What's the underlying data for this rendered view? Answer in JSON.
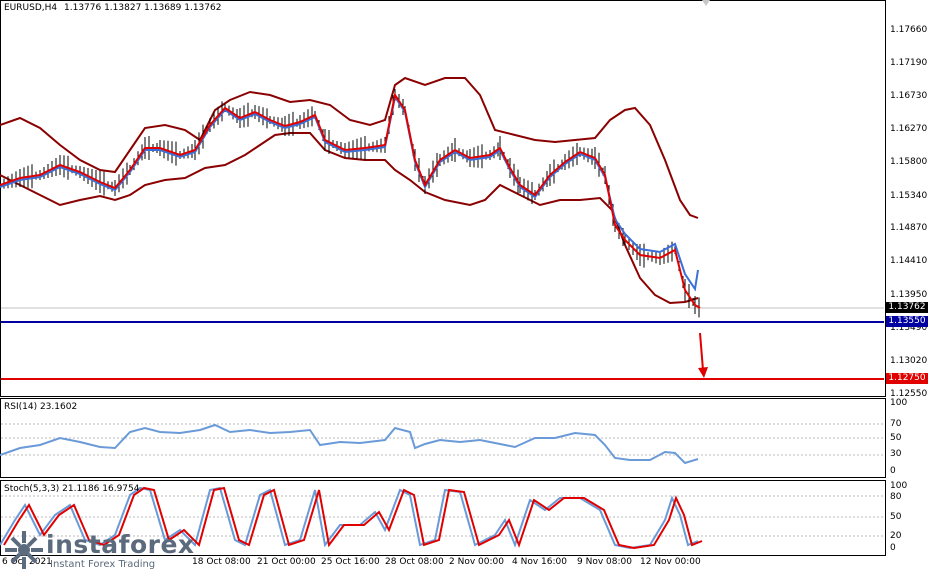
{
  "header": {
    "symbol": "EURUSD,H4",
    "ohlc": "1.13776 1.13827 1.13689 1.13762"
  },
  "price_axis": [
    "1.17660",
    "1.17190",
    "1.16730",
    "1.16270",
    "1.15800",
    "1.15340",
    "1.14870",
    "1.14410",
    "1.13950",
    "1.13490",
    "1.13020",
    "1.12550"
  ],
  "price_tags": {
    "current": {
      "label": "1.13762",
      "color": "#000000"
    },
    "blue_line": {
      "label": "1.13550",
      "color": "#0000a0"
    },
    "red_line": {
      "label": "1.12750",
      "color": "#e00000"
    }
  },
  "rsi": {
    "label": "RSI(14) 23.1602",
    "levels": [
      "100",
      "70",
      "50",
      "30",
      "0"
    ]
  },
  "stoch": {
    "label": "Stoch(5,3,3) 21.1186 16.9754",
    "levels": [
      "100",
      "80",
      "50",
      "20",
      "0"
    ]
  },
  "time_axis": [
    "6 Oct 2021",
    "18 Oct 08:00",
    "21 Oct 00:00",
    "25 Oct 16:00",
    "28 Oct 08:00",
    "2 Nov 00:00",
    "4 Nov 16:00",
    "9 Nov 08:00",
    "12 Nov 00:00"
  ],
  "logo": {
    "word": "instaforex",
    "tagline": "Instant Forex Trading"
  },
  "colors": {
    "bollinger": "#8b0000",
    "ma_fast": "#e00000",
    "ma_slow": "#3a6fd8",
    "horizontal_blue": "#0000a0",
    "horizontal_red": "#e00000",
    "rsi": "#6a9ad8",
    "stoch_main": "#6a9ad8",
    "stoch_signal": "#e00000"
  }
}
